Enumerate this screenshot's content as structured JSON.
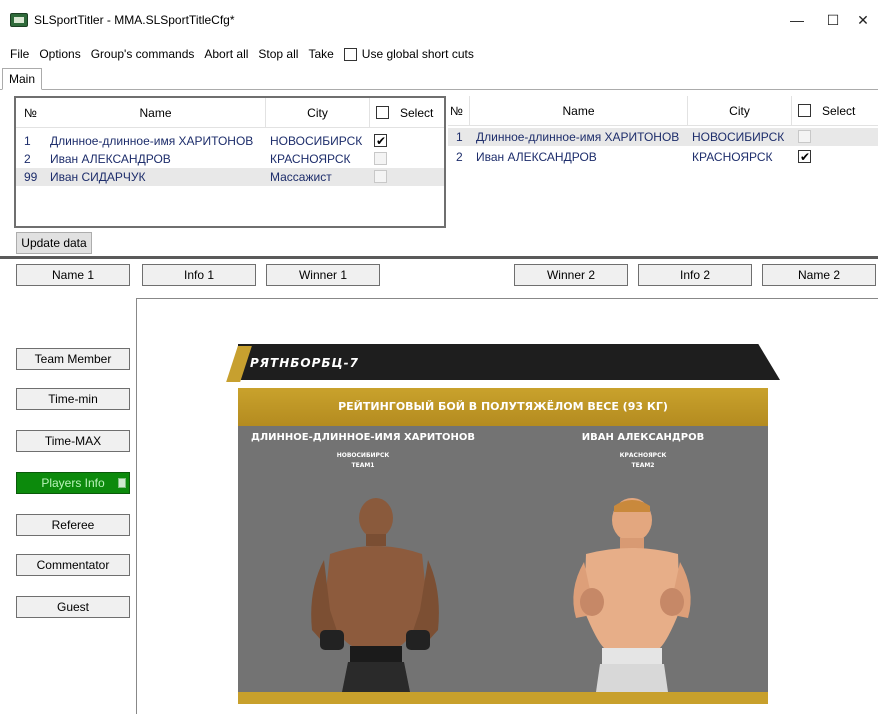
{
  "window": {
    "title": "SLSportTitler - MMA.SLSportTitleCfg*",
    "minimize_glyph": "—",
    "maximize_glyph": "☐",
    "close_glyph": "✕"
  },
  "menu": {
    "file": "File",
    "options": "Options",
    "groups": "Group's commands",
    "abort_all": "Abort all",
    "stop_all": "Stop all",
    "take": "Take",
    "use_global": "Use global short cuts"
  },
  "tabs": [
    "Main"
  ],
  "left_table": {
    "headers": {
      "num": "№",
      "name": "Name",
      "city": "City",
      "select": "Select"
    },
    "rows": [
      {
        "num": "1",
        "name": "Длинное-длинное-имя ХАРИТОНОВ",
        "city": "НОВОСИБИРСК",
        "checked": true
      },
      {
        "num": "2",
        "name": "Иван АЛЕКСАНДРОВ",
        "city": "КРАСНОЯРСК",
        "checked": false
      },
      {
        "num": "99",
        "name": "Иван СИДАРЧУК",
        "city": "Массажист",
        "checked": false
      }
    ]
  },
  "right_table": {
    "headers": {
      "num": "№",
      "name": "Name",
      "city": "City",
      "select": "Select"
    },
    "rows": [
      {
        "num": "1",
        "name": "Длинное-длинное-имя ХАРИТОНОВ",
        "city": "НОВОСИБИРСК",
        "checked": false
      },
      {
        "num": "2",
        "name": "Иван АЛЕКСАНДРОВ",
        "city": "КРАСНОЯРСК",
        "checked": true
      }
    ]
  },
  "update_button": "Update data",
  "caption_buttons": {
    "name1": "Name 1",
    "info1": "Info 1",
    "winner1": "Winner 1",
    "winner2": "Winner 2",
    "info2": "Info 2",
    "name2": "Name 2"
  },
  "side_buttons": {
    "team_member": "Team Member",
    "time_min": "Time-min",
    "time_max": "Time-MAX",
    "players_info": "Players Info",
    "referee": "Referee",
    "commentator": "Commentator",
    "guest": "Guest"
  },
  "preview": {
    "brand": "РЯТНБОРБЦ-7",
    "bout": "РЕЙТИНГОВЫЙ БОЙ В ПОЛУТЯЖЁЛОМ ВЕСЕ (93 КГ)",
    "fighter1": {
      "name": "ДЛИННОЕ-ДЛИННОЕ-ИМЯ ХАРИТОНОВ",
      "city": "НОВОСИБИРСК",
      "team": "TEAM1"
    },
    "fighter2": {
      "name": "ИВАН АЛЕКСАНДРОВ",
      "city": "КРАСНОЯРСК",
      "team": "TEAM2"
    }
  },
  "colors": {
    "active_button": "#0c8a0c",
    "gold": "#c9a22c",
    "arena_bg": "#737373",
    "link_text": "#1d2d6b"
  }
}
